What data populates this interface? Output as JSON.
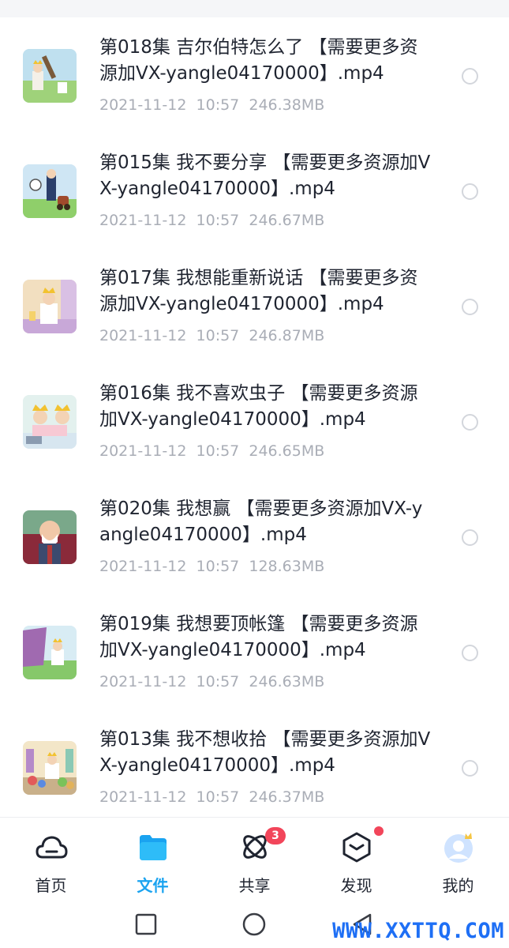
{
  "files": [
    {
      "name": "第018集 吉尔伯特怎么了 【需要更多资源加VX-yangle04170000】.mp4",
      "date": "2021-11-12",
      "time": "10:57",
      "size": "246.38MB"
    },
    {
      "name": "第015集 我不要分享 【需要更多资源加VX-yangle04170000】.mp4",
      "date": "2021-11-12",
      "time": "10:57",
      "size": "246.67MB"
    },
    {
      "name": "第017集 我想能重新说话 【需要更多资源加VX-yangle04170000】.mp4",
      "date": "2021-11-12",
      "time": "10:57",
      "size": "246.87MB"
    },
    {
      "name": "第016集 我不喜欢虫子 【需要更多资源加VX-yangle04170000】.mp4",
      "date": "2021-11-12",
      "time": "10:57",
      "size": "246.65MB"
    },
    {
      "name": "第020集 我想赢 【需要更多资源加VX-yangle04170000】.mp4",
      "date": "2021-11-12",
      "time": "10:57",
      "size": "128.63MB"
    },
    {
      "name": "第019集 我想要顶帐篷 【需要更多资源加VX-yangle04170000】.mp4",
      "date": "2021-11-12",
      "time": "10:57",
      "size": "246.63MB"
    },
    {
      "name": "第013集 我不想收拾 【需要更多资源加VX-yangle04170000】.mp4",
      "date": "2021-11-12",
      "time": "10:57",
      "size": "246.37MB"
    }
  ],
  "nav": {
    "home": {
      "label": "首页",
      "icon": "cloud-icon"
    },
    "files": {
      "label": "文件",
      "icon": "folder-icon"
    },
    "share": {
      "label": "共享",
      "icon": "atom-icon",
      "badge": "3"
    },
    "discover": {
      "label": "发现",
      "icon": "box-icon"
    },
    "me": {
      "label": "我的",
      "icon": "avatar-crown-icon"
    }
  },
  "colors": {
    "accent": "#1aa3f0",
    "badge": "#f2455a",
    "meta_text": "#a9adb6"
  },
  "watermark": "WWW.XXTTQ.COM"
}
